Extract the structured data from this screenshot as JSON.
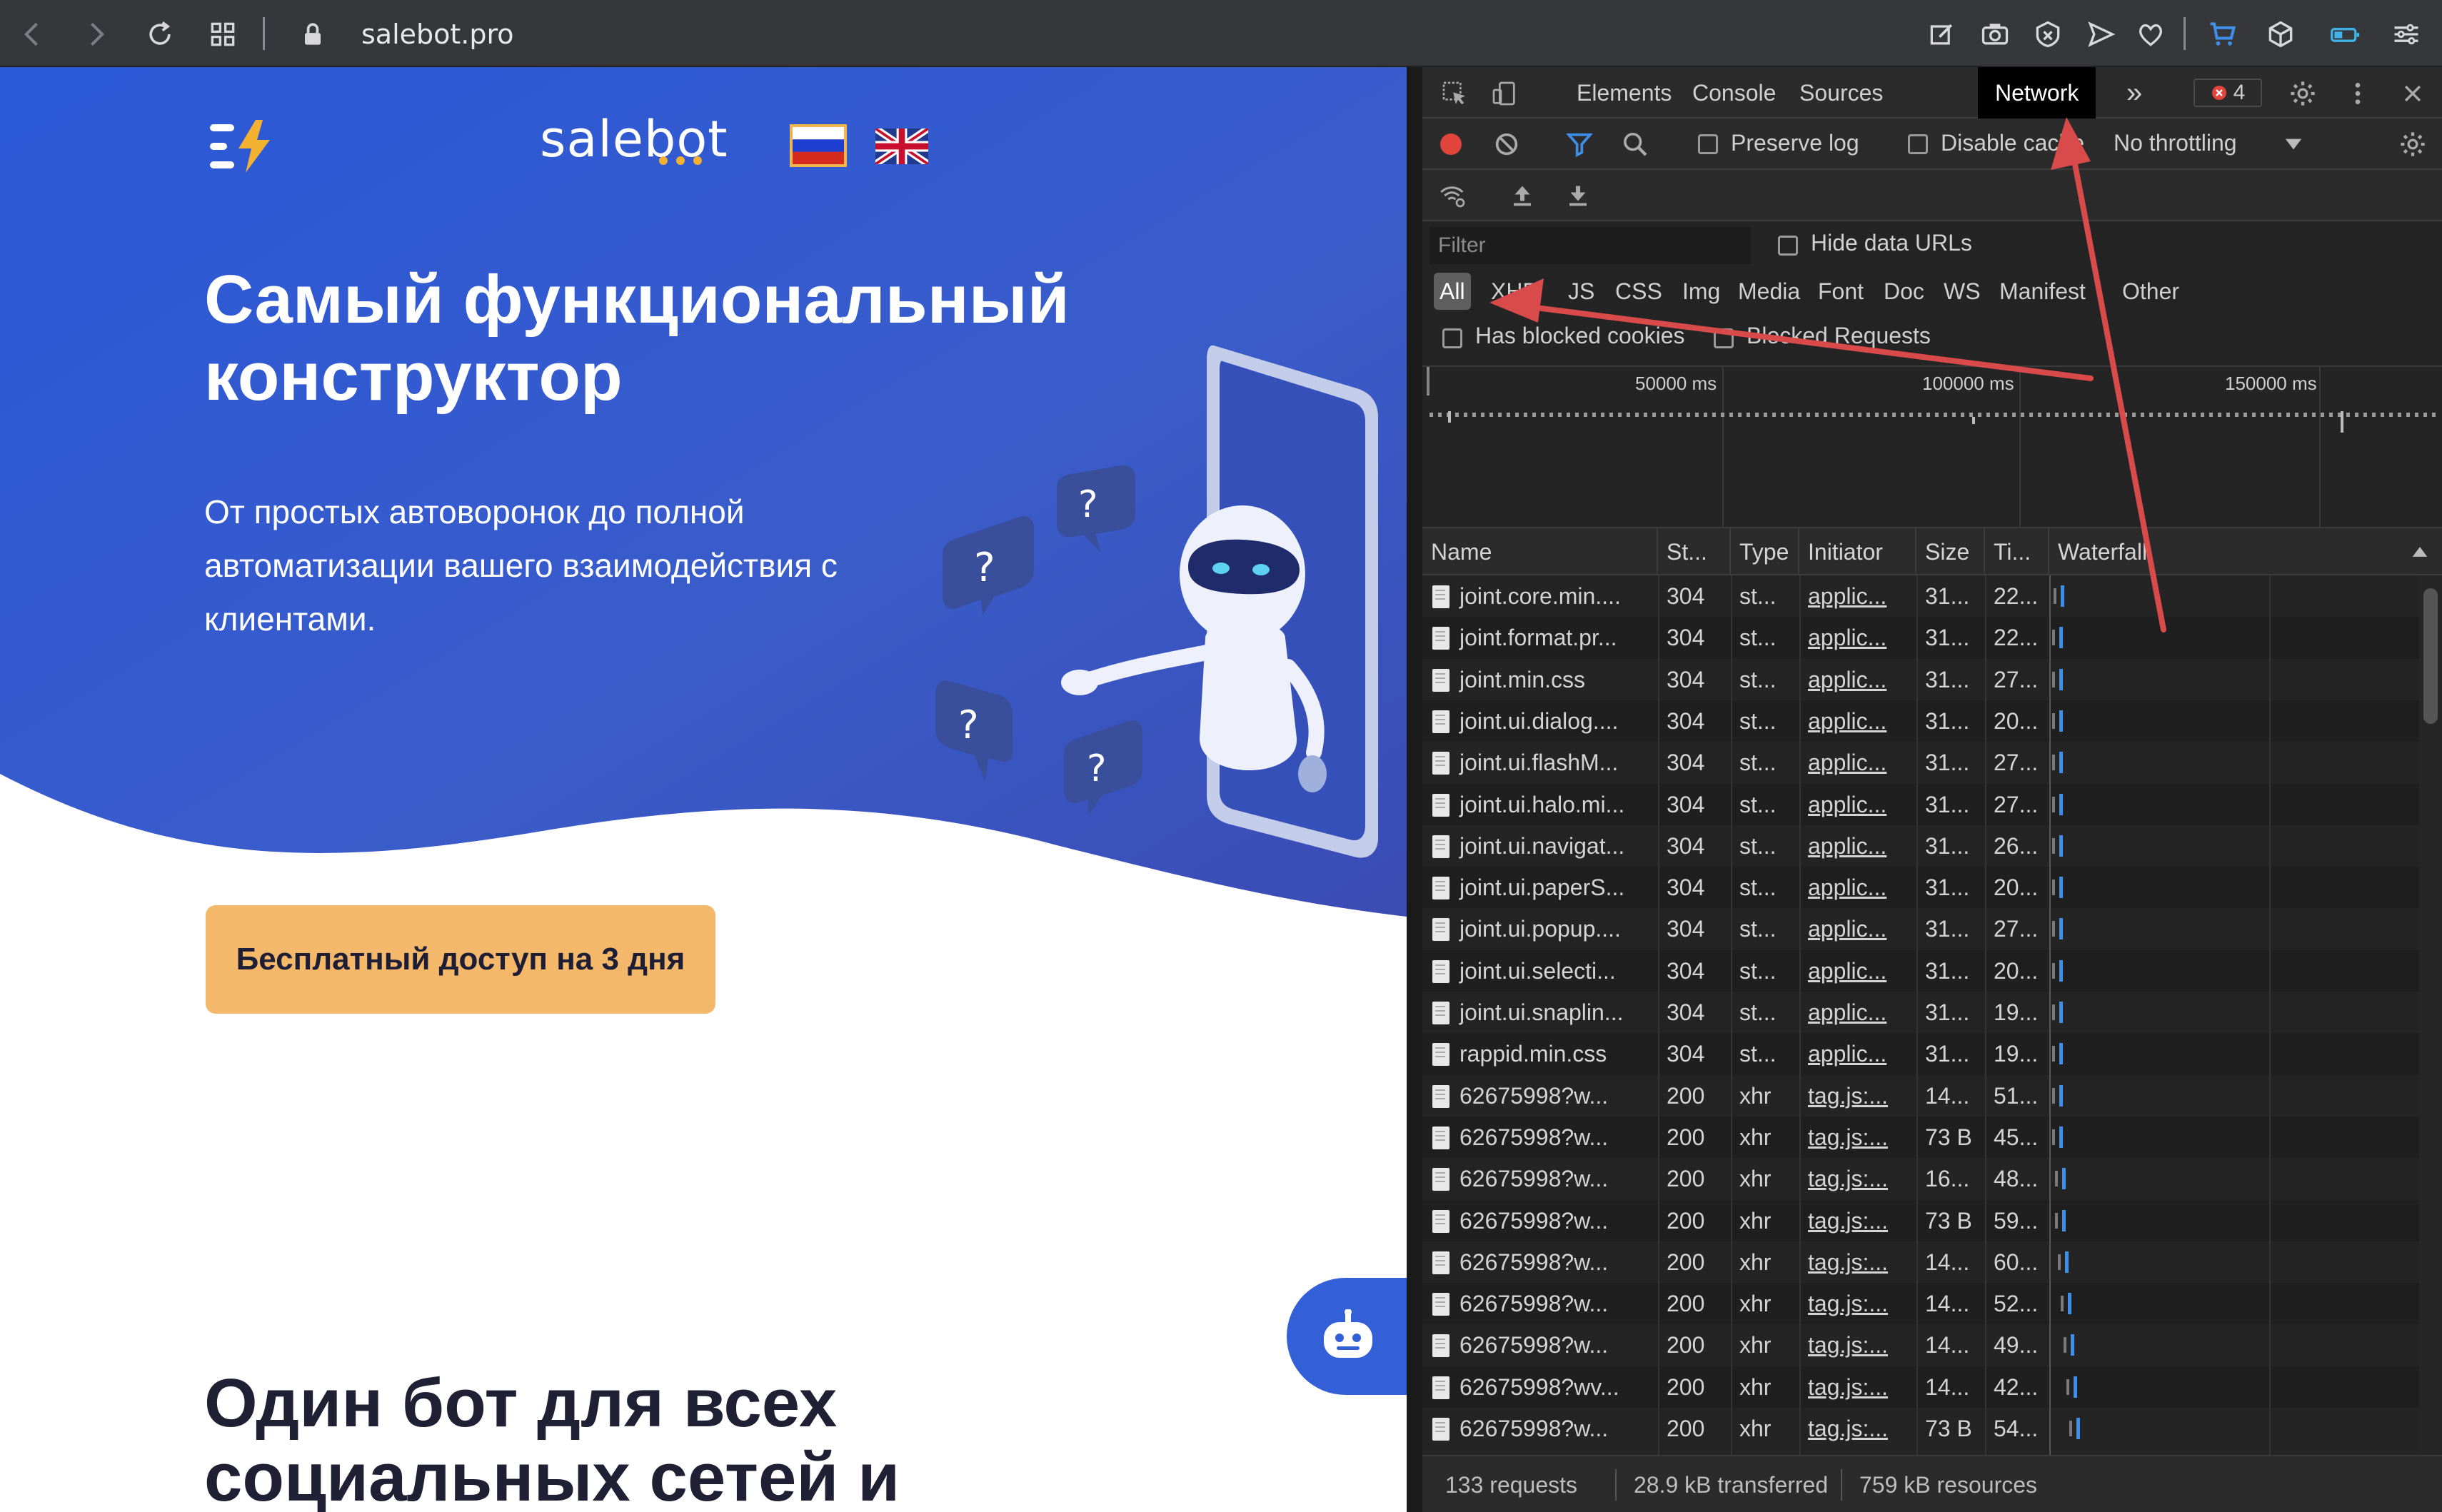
{
  "browser": {
    "url": "salebot.pro"
  },
  "site": {
    "logo_text": "salebot",
    "hero_title": "Самый функциональный конструктор",
    "hero_subtitle": "От простых автоворонок до полной автоматизации вашего взаимодействия с клиентами.",
    "cta_label": "Бесплатный доступ на 3 дня",
    "section_title": "Один бот для всех социальных сетей и",
    "colors": {
      "hero_blue": "#3460d7",
      "cta": "#f3b86a",
      "logo_accent": "#f3b132"
    }
  },
  "devtools": {
    "tabs": [
      "Elements",
      "Console",
      "Sources",
      "Network"
    ],
    "active_tab": "Network",
    "more_tabs": "»",
    "error_count": "4",
    "toolbar": {
      "preserve_log": "Preserve log",
      "disable_cache": "Disable cache",
      "throttling": "No throttling"
    },
    "filter": {
      "placeholder": "Filter",
      "hide_data_urls": "Hide data URLs",
      "types": [
        "All",
        "XHR",
        "JS",
        "CSS",
        "Img",
        "Media",
        "Font",
        "Doc",
        "WS",
        "Manifest",
        "Other"
      ],
      "active_type": "All",
      "has_blocked_cookies": "Has blocked cookies",
      "blocked_requests": "Blocked Requests"
    },
    "overview_ticks": [
      "50000 ms",
      "100000 ms",
      "150000 ms"
    ],
    "columns": [
      "Name",
      "St...",
      "Type",
      "Initiator",
      "Size",
      "Ti...",
      "Waterfall"
    ],
    "rows": [
      {
        "name": "joint.core.min....",
        "status": "304",
        "type": "st...",
        "initiator": "applic...",
        "size": "31...",
        "time": "22..."
      },
      {
        "name": "joint.format.pr...",
        "status": "304",
        "type": "st...",
        "initiator": "applic...",
        "size": "31...",
        "time": "22..."
      },
      {
        "name": "joint.min.css",
        "status": "304",
        "type": "st...",
        "initiator": "applic...",
        "size": "31...",
        "time": "27..."
      },
      {
        "name": "joint.ui.dialog....",
        "status": "304",
        "type": "st...",
        "initiator": "applic...",
        "size": "31...",
        "time": "20..."
      },
      {
        "name": "joint.ui.flashM...",
        "status": "304",
        "type": "st...",
        "initiator": "applic...",
        "size": "31...",
        "time": "27..."
      },
      {
        "name": "joint.ui.halo.mi...",
        "status": "304",
        "type": "st...",
        "initiator": "applic...",
        "size": "31...",
        "time": "27..."
      },
      {
        "name": "joint.ui.navigat...",
        "status": "304",
        "type": "st...",
        "initiator": "applic...",
        "size": "31...",
        "time": "26..."
      },
      {
        "name": "joint.ui.paperS...",
        "status": "304",
        "type": "st...",
        "initiator": "applic...",
        "size": "31...",
        "time": "20..."
      },
      {
        "name": "joint.ui.popup....",
        "status": "304",
        "type": "st...",
        "initiator": "applic...",
        "size": "31...",
        "time": "27..."
      },
      {
        "name": "joint.ui.selecti...",
        "status": "304",
        "type": "st...",
        "initiator": "applic...",
        "size": "31...",
        "time": "20..."
      },
      {
        "name": "joint.ui.snaplin...",
        "status": "304",
        "type": "st...",
        "initiator": "applic...",
        "size": "31...",
        "time": "19..."
      },
      {
        "name": "rappid.min.css",
        "status": "304",
        "type": "st...",
        "initiator": "applic...",
        "size": "31...",
        "time": "19..."
      },
      {
        "name": "62675998?w...",
        "status": "200",
        "type": "xhr",
        "initiator": "tag.js:...",
        "size": "14...",
        "time": "51..."
      },
      {
        "name": "62675998?w...",
        "status": "200",
        "type": "xhr",
        "initiator": "tag.js:...",
        "size": "73 B",
        "time": "45..."
      },
      {
        "name": "62675998?w...",
        "status": "200",
        "type": "xhr",
        "initiator": "tag.js:...",
        "size": "16...",
        "time": "48..."
      },
      {
        "name": "62675998?w...",
        "status": "200",
        "type": "xhr",
        "initiator": "tag.js:...",
        "size": "73 B",
        "time": "59..."
      },
      {
        "name": "62675998?w...",
        "status": "200",
        "type": "xhr",
        "initiator": "tag.js:...",
        "size": "14...",
        "time": "60..."
      },
      {
        "name": "62675998?w...",
        "status": "200",
        "type": "xhr",
        "initiator": "tag.js:...",
        "size": "14...",
        "time": "52..."
      },
      {
        "name": "62675998?w...",
        "status": "200",
        "type": "xhr",
        "initiator": "tag.js:...",
        "size": "14...",
        "time": "49..."
      },
      {
        "name": "62675998?wv...",
        "status": "200",
        "type": "xhr",
        "initiator": "tag.js:...",
        "size": "14...",
        "time": "42..."
      },
      {
        "name": "62675998?w...",
        "status": "200",
        "type": "xhr",
        "initiator": "tag.js:...",
        "size": "73 B",
        "time": "54..."
      }
    ],
    "status_bar": {
      "requests": "133 requests",
      "transferred": "28.9 kB transferred",
      "resources": "759 kB resources"
    }
  }
}
